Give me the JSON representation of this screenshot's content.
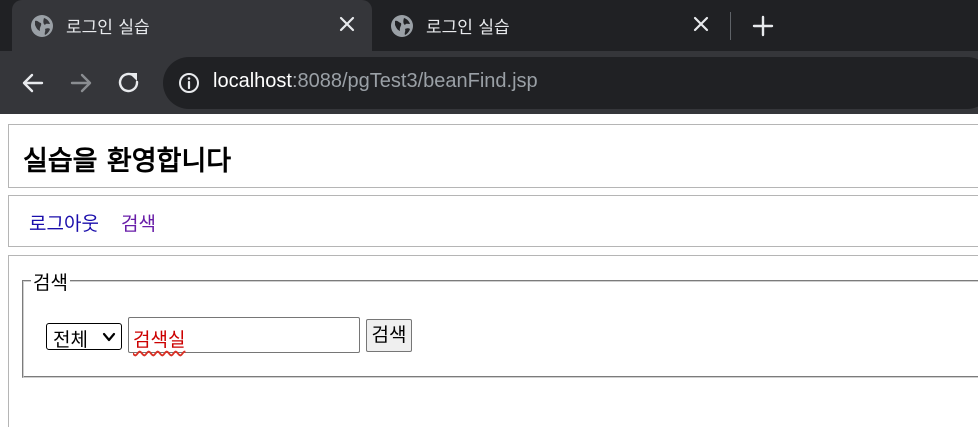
{
  "browser": {
    "tabs": [
      {
        "title": "로그인 실습",
        "active": true
      },
      {
        "title": "로그인 실습",
        "active": false
      }
    ],
    "url": {
      "host": "localhost",
      "rest": ":8088/pgTest3/beanFind.jsp"
    }
  },
  "page": {
    "heading": "실습을 환영합니다",
    "nav": {
      "logout": "로그아웃",
      "search": "검색"
    },
    "search_form": {
      "legend": "검색",
      "select_value": "전체",
      "input_value": "검색실",
      "button_label": "검색"
    }
  },
  "colors": {
    "chrome_dark": "#202124",
    "chrome_tab": "#35363a",
    "link": "#1a0dab",
    "visited_link": "#681da8",
    "input_text": "#cc0000"
  }
}
